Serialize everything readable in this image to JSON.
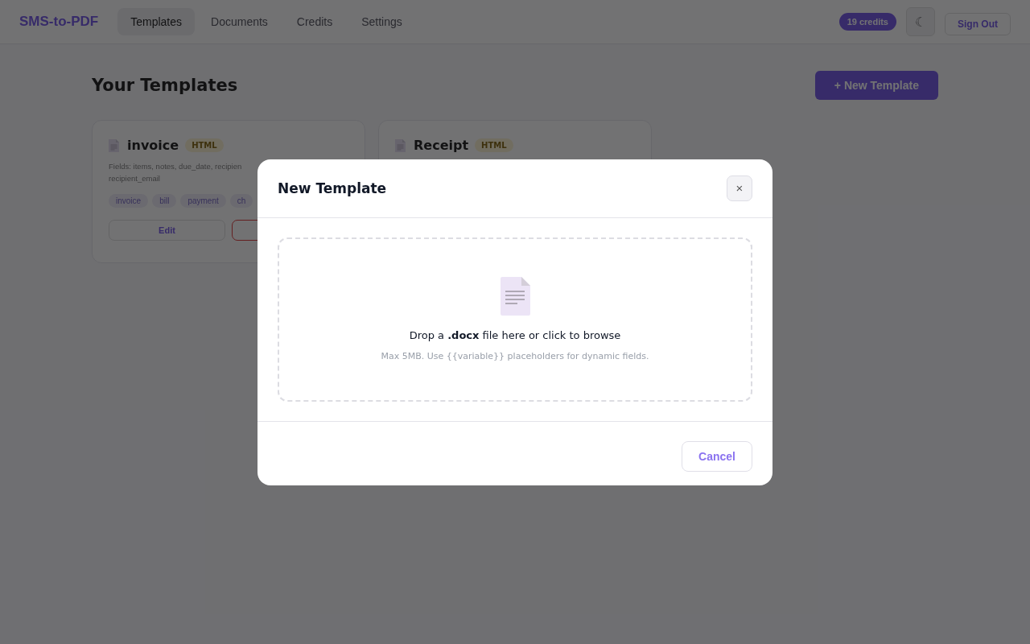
{
  "nav": {
    "logo": "SMS-to-PDF",
    "tabs": [
      {
        "label": "Templates",
        "selected": true
      },
      {
        "label": "Documents",
        "selected": false
      },
      {
        "label": "Credits",
        "selected": false
      },
      {
        "label": "Settings",
        "selected": false
      }
    ],
    "credits": "19 credits",
    "theme_toggle": "☾",
    "sign_out": "Sign Out"
  },
  "page": {
    "title": "Your Templates",
    "new_button": "+ New Template"
  },
  "templates": [
    {
      "name": "invoice",
      "format": "HTML",
      "fields": "Fields: items, notes, due_date, recipien\nrecipient_email",
      "tags": [
        "invoice",
        "bill",
        "payment",
        "ch"
      ],
      "buttons": [
        {
          "kind": "edit",
          "label": "Edit"
        },
        {
          "kind": "delete"
        }
      ]
    },
    {
      "name": "Receipt",
      "format": "HTML"
    }
  ],
  "modal": {
    "title": "New Template",
    "close": "×",
    "drop_text": "Drop a **.docx** file here or click to browse",
    "hint": "Max 5MB. Use {{variable}} placeholders for dynamic fields.",
    "cancel": "Cancel"
  }
}
